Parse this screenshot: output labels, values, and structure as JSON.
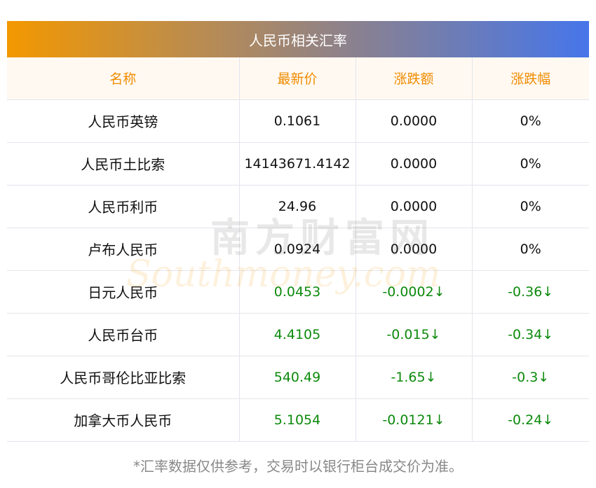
{
  "title": "人民币相关汇率",
  "columns": [
    "名称",
    "最新价",
    "涨跌额",
    "涨跌幅"
  ],
  "rows": [
    {
      "name": "人民币英镑",
      "price": "0.1061",
      "change": "0.0000",
      "pct": "0%",
      "down": false
    },
    {
      "name": "人民币土比索",
      "price": "14143671.4142",
      "change": "0.0000",
      "pct": "0%",
      "down": false
    },
    {
      "name": "人民币利币",
      "price": "24.96",
      "change": "0.0000",
      "pct": "0%",
      "down": false
    },
    {
      "name": "卢布人民币",
      "price": "0.0924",
      "change": "0.0000",
      "pct": "0%",
      "down": false
    },
    {
      "name": "日元人民币",
      "price": "0.0453",
      "change": "-0.0002↓",
      "pct": "-0.36↓",
      "down": true
    },
    {
      "name": "人民币台币",
      "price": "4.4105",
      "change": "-0.015↓",
      "pct": "-0.34↓",
      "down": true
    },
    {
      "name": "人民币哥伦比亚比索",
      "price": "540.49",
      "change": "-1.65↓",
      "pct": "-0.3↓",
      "down": true
    },
    {
      "name": "加拿大币人民币",
      "price": "5.1054",
      "change": "-0.0121↓",
      "pct": "-0.24↓",
      "down": true
    }
  ],
  "footer": "*汇率数据仅供参考，交易时以银行柜台成交价为准。",
  "watermark": {
    "cn": "南方财富网",
    "en": "Southmoney.com"
  },
  "colors": {
    "header_text": "#f08c00",
    "down": "#0c8a0c"
  }
}
